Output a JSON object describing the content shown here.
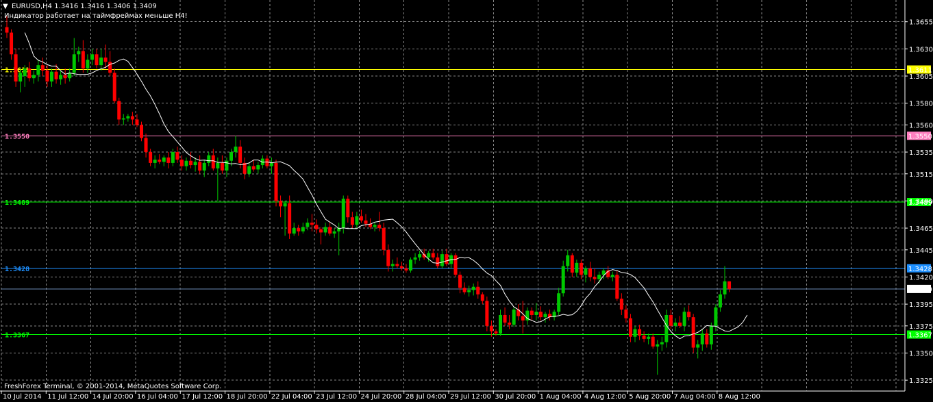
{
  "header": {
    "symbol_line": "EURUSD,H4  1.3416 1.3416 1.3406 1.3409",
    "indicator_note": "Индикатор работает на таймфреймах меньше H4!",
    "copyright": "FreshForex Terminal, © 2001-2014, MetaQuotes Software Corp."
  },
  "colors": {
    "background": "#000000",
    "grid": "#8a8a8a",
    "bull": "#00c800",
    "bear": "#ff0000",
    "ma": "#ffffff",
    "axis_text": "#ffffff"
  },
  "chart_data": {
    "type": "candlestick",
    "symbol": "EURUSD",
    "timeframe": "H4",
    "ylim": [
      1.3315,
      1.3675
    ],
    "y_ticks": [
      "1.3655",
      "1.3630",
      "1.3605",
      "1.3580",
      "1.3560",
      "1.3535",
      "1.3515",
      "1.3490",
      "1.3465",
      "1.3445",
      "1.3420",
      "1.3395",
      "1.3375",
      "1.3350",
      "1.3325"
    ],
    "y_tick_values": [
      1.3655,
      1.363,
      1.3605,
      1.358,
      1.356,
      1.3535,
      1.3515,
      1.349,
      1.3465,
      1.3445,
      1.342,
      1.3395,
      1.3375,
      1.335,
      1.3325
    ],
    "x_ticks": [
      "10 Jul 2014",
      "11 Jul 12:00",
      "14 Jul 20:00",
      "16 Jul 04:00",
      "17 Jul 12:00",
      "18 Jul 20:00",
      "22 Jul 04:00",
      "23 Jul 12:00",
      "24 Jul 20:00",
      "28 Jul 04:00",
      "29 Jul 12:00",
      "30 Jul 20:00",
      "1 Aug 04:00",
      "4 Aug 12:00",
      "5 Aug 20:00",
      "7 Aug 04:00",
      "8 Aug 12:00"
    ],
    "grid": true,
    "current_price": {
      "label": "1.3409",
      "value": 1.3409,
      "color": "#ffffff"
    },
    "levels": [
      {
        "label": "1.3611",
        "value": 1.3611,
        "color": "#ffff00",
        "left_label": "1.3611"
      },
      {
        "label": "1.3550",
        "value": 1.355,
        "color": "#ff7fbf",
        "left_label": "1.3550"
      },
      {
        "label": "1.3489",
        "value": 1.3489,
        "color": "#00ff00",
        "left_label": "1.3489"
      },
      {
        "label": "1.3428",
        "value": 1.3428,
        "color": "#1e90ff",
        "left_label": "1.3428"
      },
      {
        "label": "1.3367",
        "value": 1.3367,
        "color": "#00ff00",
        "left_label": "1.3367"
      }
    ],
    "candles": [
      [
        1.365,
        1.366,
        1.364,
        1.3645
      ],
      [
        1.3645,
        1.3648,
        1.362,
        1.3625
      ],
      [
        1.3625,
        1.363,
        1.3595,
        1.36
      ],
      [
        1.36,
        1.3612,
        1.359,
        1.3608
      ],
      [
        1.3605,
        1.3615,
        1.3595,
        1.3612
      ],
      [
        1.3612,
        1.3618,
        1.36,
        1.3603
      ],
      [
        1.3603,
        1.361,
        1.3598,
        1.3606
      ],
      [
        1.3606,
        1.362,
        1.36,
        1.3615
      ],
      [
        1.3615,
        1.3622,
        1.3605,
        1.361
      ],
      [
        1.361,
        1.3615,
        1.3595,
        1.36
      ],
      [
        1.36,
        1.3612,
        1.3595,
        1.3609
      ],
      [
        1.3609,
        1.3616,
        1.3598,
        1.3602
      ],
      [
        1.3602,
        1.361,
        1.3597,
        1.3606
      ],
      [
        1.3606,
        1.3612,
        1.3598,
        1.3603
      ],
      [
        1.3603,
        1.3612,
        1.36,
        1.3608
      ],
      [
        1.3608,
        1.364,
        1.3605,
        1.3625
      ],
      [
        1.3625,
        1.3632,
        1.3618,
        1.3628
      ],
      [
        1.3628,
        1.3638,
        1.3608,
        1.3612
      ],
      [
        1.3612,
        1.3625,
        1.3608,
        1.362
      ],
      [
        1.362,
        1.363,
        1.3615,
        1.3625
      ],
      [
        1.3625,
        1.363,
        1.3612,
        1.3615
      ],
      [
        1.3615,
        1.363,
        1.361,
        1.3622
      ],
      [
        1.3622,
        1.3634,
        1.3612,
        1.3618
      ],
      [
        1.3618,
        1.3628,
        1.3605,
        1.3608
      ],
      [
        1.3608,
        1.3612,
        1.358,
        1.3582
      ],
      [
        1.3582,
        1.3585,
        1.356,
        1.3565
      ],
      [
        1.3565,
        1.357,
        1.356,
        1.3566
      ],
      [
        1.3566,
        1.357,
        1.3563,
        1.3568
      ],
      [
        1.3568,
        1.3572,
        1.356,
        1.3565
      ],
      [
        1.3565,
        1.357,
        1.3558,
        1.356
      ],
      [
        1.356,
        1.3563,
        1.3545,
        1.3548
      ],
      [
        1.3548,
        1.3552,
        1.353,
        1.3535
      ],
      [
        1.3535,
        1.3538,
        1.3522,
        1.3525
      ],
      [
        1.3525,
        1.3532,
        1.352,
        1.3528
      ],
      [
        1.3528,
        1.3533,
        1.3524,
        1.3526
      ],
      [
        1.3526,
        1.3532,
        1.3522,
        1.353
      ],
      [
        1.353,
        1.3535,
        1.352,
        1.3525
      ],
      [
        1.3525,
        1.3538,
        1.3522,
        1.3535
      ],
      [
        1.3535,
        1.354,
        1.3525,
        1.3528
      ],
      [
        1.3528,
        1.3532,
        1.3518,
        1.3522
      ],
      [
        1.3522,
        1.353,
        1.3518,
        1.3527
      ],
      [
        1.3527,
        1.3535,
        1.352,
        1.3523
      ],
      [
        1.3523,
        1.353,
        1.3517,
        1.3526
      ],
      [
        1.3526,
        1.3532,
        1.3515,
        1.3518
      ],
      [
        1.3518,
        1.3528,
        1.3512,
        1.3525
      ],
      [
        1.3525,
        1.3535,
        1.3522,
        1.3532
      ],
      [
        1.3532,
        1.3538,
        1.3518,
        1.352
      ],
      [
        1.352,
        1.353,
        1.349,
        1.3525
      ],
      [
        1.3525,
        1.3532,
        1.3515,
        1.3518
      ],
      [
        1.3518,
        1.353,
        1.3512,
        1.3527
      ],
      [
        1.3527,
        1.3538,
        1.3522,
        1.3535
      ],
      [
        1.3535,
        1.355,
        1.353,
        1.354
      ],
      [
        1.354,
        1.3546,
        1.352,
        1.3525
      ],
      [
        1.3525,
        1.353,
        1.351,
        1.3515
      ],
      [
        1.3515,
        1.3525,
        1.3512,
        1.3522
      ],
      [
        1.3522,
        1.3528,
        1.3517,
        1.3519
      ],
      [
        1.3519,
        1.3526,
        1.3515,
        1.3523
      ],
      [
        1.3523,
        1.3532,
        1.352,
        1.3529
      ],
      [
        1.3529,
        1.3532,
        1.352,
        1.3522
      ],
      [
        1.3522,
        1.353,
        1.3515,
        1.3525
      ],
      [
        1.3525,
        1.3528,
        1.3485,
        1.349
      ],
      [
        1.349,
        1.3495,
        1.3475,
        1.3485
      ],
      [
        1.3485,
        1.349,
        1.3458,
        1.3488
      ],
      [
        1.3488,
        1.3495,
        1.3455,
        1.346
      ],
      [
        1.346,
        1.347,
        1.3458,
        1.3465
      ],
      [
        1.3465,
        1.3468,
        1.3458,
        1.3462
      ],
      [
        1.3462,
        1.347,
        1.346,
        1.3466
      ],
      [
        1.3466,
        1.3474,
        1.3463,
        1.347
      ],
      [
        1.347,
        1.3478,
        1.3462,
        1.3468
      ],
      [
        1.3468,
        1.3473,
        1.346,
        1.3464
      ],
      [
        1.3464,
        1.3466,
        1.345,
        1.3461
      ],
      [
        1.3461,
        1.347,
        1.3458,
        1.3466
      ],
      [
        1.3466,
        1.347,
        1.3458,
        1.346
      ],
      [
        1.346,
        1.3465,
        1.3456,
        1.3462
      ],
      [
        1.3462,
        1.347,
        1.344,
        1.3465
      ],
      [
        1.3465,
        1.3495,
        1.346,
        1.3492
      ],
      [
        1.3492,
        1.3495,
        1.347,
        1.3475
      ],
      [
        1.3475,
        1.348,
        1.3465,
        1.3468
      ],
      [
        1.3468,
        1.348,
        1.3465,
        1.3476
      ],
      [
        1.3476,
        1.3482,
        1.347,
        1.3472
      ],
      [
        1.3472,
        1.3478,
        1.3466,
        1.3469
      ],
      [
        1.3469,
        1.3474,
        1.3464,
        1.3466
      ],
      [
        1.3466,
        1.347,
        1.3462,
        1.3468
      ],
      [
        1.3468,
        1.348,
        1.3462,
        1.3465
      ],
      [
        1.3465,
        1.347,
        1.344,
        1.3445
      ],
      [
        1.3445,
        1.345,
        1.3425,
        1.343
      ],
      [
        1.343,
        1.3436,
        1.3425,
        1.3432
      ],
      [
        1.3432,
        1.3438,
        1.3428,
        1.343
      ],
      [
        1.343,
        1.3434,
        1.3426,
        1.3428
      ],
      [
        1.3428,
        1.3432,
        1.3424,
        1.3426
      ],
      [
        1.3426,
        1.3438,
        1.3424,
        1.3436
      ],
      [
        1.3436,
        1.3442,
        1.3432,
        1.3438
      ],
      [
        1.3438,
        1.3444,
        1.3435,
        1.3441
      ],
      [
        1.3441,
        1.3446,
        1.3436,
        1.3438
      ],
      [
        1.3438,
        1.3444,
        1.3434,
        1.3442
      ],
      [
        1.3442,
        1.3446,
        1.3436,
        1.3438
      ],
      [
        1.3438,
        1.3442,
        1.3428,
        1.343
      ],
      [
        1.343,
        1.3444,
        1.3428,
        1.3441
      ],
      [
        1.3441,
        1.3446,
        1.343,
        1.3432
      ],
      [
        1.3432,
        1.3442,
        1.3428,
        1.344
      ],
      [
        1.344,
        1.3442,
        1.342,
        1.3422
      ],
      [
        1.3422,
        1.3425,
        1.3405,
        1.341
      ],
      [
        1.341,
        1.3415,
        1.3404,
        1.3406
      ],
      [
        1.3406,
        1.3412,
        1.3402,
        1.3408
      ],
      [
        1.3408,
        1.3414,
        1.3403,
        1.3411
      ],
      [
        1.3411,
        1.3416,
        1.34,
        1.3404
      ],
      [
        1.3404,
        1.3406,
        1.3395,
        1.3398
      ],
      [
        1.3398,
        1.3402,
        1.337,
        1.3375
      ],
      [
        1.3375,
        1.338,
        1.3365,
        1.337
      ],
      [
        1.337,
        1.3372,
        1.3366,
        1.3368
      ],
      [
        1.3368,
        1.339,
        1.3366,
        1.3385
      ],
      [
        1.3385,
        1.3392,
        1.3375,
        1.3378
      ],
      [
        1.3378,
        1.3385,
        1.3372,
        1.3376
      ],
      [
        1.3376,
        1.3392,
        1.3374,
        1.339
      ],
      [
        1.339,
        1.3395,
        1.338,
        1.3384
      ],
      [
        1.3384,
        1.3398,
        1.3368,
        1.338
      ],
      [
        1.338,
        1.3392,
        1.3376,
        1.3389
      ],
      [
        1.3389,
        1.3392,
        1.338,
        1.3385
      ],
      [
        1.3385,
        1.3396,
        1.338,
        1.3388
      ],
      [
        1.3388,
        1.3393,
        1.338,
        1.3383
      ],
      [
        1.3383,
        1.3388,
        1.3378,
        1.3386
      ],
      [
        1.3386,
        1.339,
        1.338,
        1.3383
      ],
      [
        1.3383,
        1.339,
        1.338,
        1.3388
      ],
      [
        1.3388,
        1.341,
        1.3385,
        1.3405
      ],
      [
        1.3405,
        1.3435,
        1.3402,
        1.343
      ],
      [
        1.343,
        1.3445,
        1.3425,
        1.344
      ],
      [
        1.344,
        1.3442,
        1.342,
        1.3424
      ],
      [
        1.3424,
        1.3436,
        1.342,
        1.3433
      ],
      [
        1.3433,
        1.3436,
        1.3418,
        1.3422
      ],
      [
        1.3422,
        1.343,
        1.3415,
        1.3428
      ],
      [
        1.3428,
        1.3434,
        1.3416,
        1.342
      ],
      [
        1.342,
        1.3428,
        1.3414,
        1.3418
      ],
      [
        1.3418,
        1.3425,
        1.3414,
        1.3422
      ],
      [
        1.3422,
        1.3428,
        1.3418,
        1.3426
      ],
      [
        1.3426,
        1.343,
        1.3418,
        1.342
      ],
      [
        1.342,
        1.3425,
        1.3416,
        1.3422
      ],
      [
        1.3422,
        1.3426,
        1.3398,
        1.34
      ],
      [
        1.34,
        1.3405,
        1.3385,
        1.339
      ],
      [
        1.339,
        1.3394,
        1.3378,
        1.3382
      ],
      [
        1.3382,
        1.3386,
        1.336,
        1.3365
      ],
      [
        1.3365,
        1.3375,
        1.336,
        1.3372
      ],
      [
        1.3372,
        1.3376,
        1.3362,
        1.3366
      ],
      [
        1.3366,
        1.337,
        1.336,
        1.3363
      ],
      [
        1.3363,
        1.3368,
        1.3358,
        1.3365
      ],
      [
        1.3365,
        1.3368,
        1.3354,
        1.3356
      ],
      [
        1.3356,
        1.3362,
        1.333,
        1.3358
      ],
      [
        1.3358,
        1.3365,
        1.3352,
        1.336
      ],
      [
        1.336,
        1.339,
        1.3355,
        1.3385
      ],
      [
        1.3385,
        1.339,
        1.3372,
        1.3375
      ],
      [
        1.3375,
        1.3382,
        1.337,
        1.3378
      ],
      [
        1.3378,
        1.3384,
        1.3373,
        1.3375
      ],
      [
        1.3375,
        1.3392,
        1.337,
        1.3388
      ],
      [
        1.3388,
        1.3394,
        1.338,
        1.3383
      ],
      [
        1.3383,
        1.3386,
        1.335,
        1.3355
      ],
      [
        1.3355,
        1.3362,
        1.3345,
        1.3358
      ],
      [
        1.3358,
        1.3372,
        1.3352,
        1.3368
      ],
      [
        1.3368,
        1.3372,
        1.3355,
        1.3358
      ],
      [
        1.3358,
        1.3378,
        1.3353,
        1.3375
      ],
      [
        1.3375,
        1.3395,
        1.337,
        1.3392
      ],
      [
        1.3392,
        1.3408,
        1.3388,
        1.3404
      ],
      [
        1.3404,
        1.343,
        1.34,
        1.3416
      ],
      [
        1.3416,
        1.3416,
        1.3406,
        1.3409
      ]
    ]
  }
}
